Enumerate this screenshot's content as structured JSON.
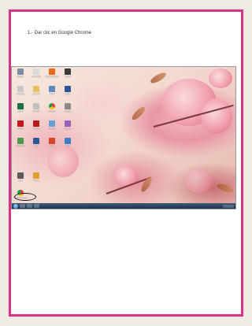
{
  "document": {
    "instruction": "1.- Dar clic en Google Chrome"
  },
  "desktop": {
    "icons": [
      {
        "name": "computer-icon",
        "label": "Equipo",
        "color": "#7a8aa0"
      },
      {
        "name": "notepad-icon",
        "label": "Mi recurso",
        "color": "#d9d9d9"
      },
      {
        "name": "firefox-icon",
        "label": "Mozilla Firefox",
        "color": "#e8681c"
      },
      {
        "name": "video-icon",
        "label": "VIDEO",
        "color": "#3a3a3a"
      },
      {
        "name": "recycle-bin-icon",
        "label": "Papelera",
        "color": "#c8c8c8"
      },
      {
        "name": "folder-icon",
        "label": "Carpeta",
        "color": "#e4c15a"
      },
      {
        "name": "network-icon",
        "label": "Red",
        "color": "#5a8ac0"
      },
      {
        "name": "word-icon",
        "label": "Word",
        "color": "#2b5797"
      },
      {
        "name": "excel-icon",
        "label": "Excel",
        "color": "#1e7145"
      },
      {
        "name": "file-icon",
        "label": "Archivo",
        "color": "#bfbfbf"
      },
      {
        "name": "chrome-icon-small",
        "label": "Chrome",
        "color": "#e04b3a"
      },
      {
        "name": "settings-icon",
        "label": "Config",
        "color": "#8a8a8a"
      },
      {
        "name": "pdf-icon",
        "label": "Adobe",
        "color": "#c8161d"
      },
      {
        "name": "acrobat-icon",
        "label": "Reader",
        "color": "#b71c1c"
      },
      {
        "name": "image-icon",
        "label": "Imagen",
        "color": "#6a9fd8"
      },
      {
        "name": "music-icon",
        "label": "Musica",
        "color": "#9a5fb8"
      },
      {
        "name": "program-icon",
        "label": "Programa",
        "color": "#4a9a4a"
      },
      {
        "name": "word-doc-icon",
        "label": "Doc",
        "color": "#2b5797"
      },
      {
        "name": "ppt-icon",
        "label": "PPT",
        "color": "#d24726"
      },
      {
        "name": "app-icon",
        "label": "App",
        "color": "#3c7dc4"
      },
      {
        "name": "calc-icon",
        "label": "Calc",
        "color": "#5a5a5a"
      },
      {
        "name": "paint-icon",
        "label": "Paint",
        "color": "#e0a030"
      },
      {
        "name": "google-chrome-icon",
        "label": "Google Chrome",
        "color": "#e04b3a"
      }
    ]
  },
  "colors": {
    "page_border": "#d63384",
    "highlight_circle": "#1a1a1a",
    "taskbar": "#2a4465"
  }
}
